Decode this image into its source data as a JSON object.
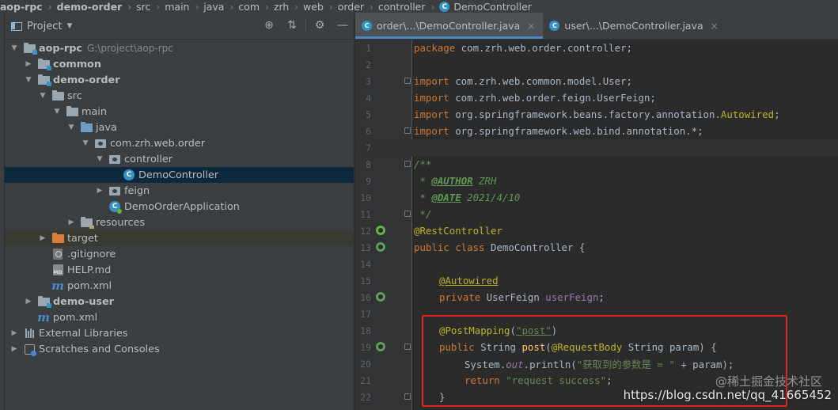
{
  "breadcrumb": {
    "items": [
      "aop-rpc",
      "demo-order",
      "src",
      "main",
      "java",
      "com",
      "zrh",
      "web",
      "order",
      "controller",
      "DemoController"
    ]
  },
  "project_panel": {
    "title": "Project",
    "tree": [
      {
        "label": "aop-rpc",
        "hint": "G:\\project\\aop-rpc"
      },
      {
        "label": "common"
      },
      {
        "label": "demo-order"
      },
      {
        "label": "src"
      },
      {
        "label": "main"
      },
      {
        "label": "java"
      },
      {
        "label": "com.zrh.web.order"
      },
      {
        "label": "controller"
      },
      {
        "label": "DemoController"
      },
      {
        "label": "feign"
      },
      {
        "label": "DemoOrderApplication"
      },
      {
        "label": "resources"
      },
      {
        "label": "target"
      },
      {
        "label": ".gitignore"
      },
      {
        "label": "HELP.md"
      },
      {
        "label": "pom.xml"
      },
      {
        "label": "demo-user"
      },
      {
        "label": "pom.xml"
      },
      {
        "label": "External Libraries"
      },
      {
        "label": "Scratches and Consoles"
      }
    ]
  },
  "editor": {
    "tabs": [
      {
        "label": "order\\...\\DemoController.java",
        "active": true
      },
      {
        "label": "user\\...\\DemoController.java",
        "active": false
      }
    ],
    "line_numbers": [
      "1",
      "2",
      "3",
      "4",
      "5",
      "6",
      "7",
      "8",
      "9",
      "10",
      "11",
      "12",
      "13",
      "14",
      "15",
      "16",
      "17",
      "18",
      "19",
      "20",
      "21",
      "22"
    ],
    "lines": {
      "l1": [
        "package",
        " com.zrh.web.order.controller;"
      ],
      "l3": [
        "import",
        " com.zrh.web.common.model.User;"
      ],
      "l4": [
        "import",
        " com.zrh.web.order.feign.UserFeign;"
      ],
      "l5": [
        "import",
        " org.springframework.beans.factory.annotation.",
        "Autowired",
        ";"
      ],
      "l6": [
        "import",
        " org.springframework.web.bind.annotation.*;"
      ],
      "l8": "/**",
      "l9": [
        " * ",
        "@AUTHOR",
        " ZRH"
      ],
      "l10": [
        " * ",
        "@DATE",
        " 2021/4/10"
      ],
      "l11": " */",
      "l12": "@RestController",
      "l13": [
        "public class",
        " DemoController {"
      ],
      "l15": "@Autowired",
      "l16": [
        "private",
        " UserFeign ",
        "userFeign",
        ";"
      ],
      "l18": [
        "@PostMapping",
        "(",
        "\"post\"",
        ")"
      ],
      "l19": [
        "public",
        " String ",
        "post",
        "(",
        "@RequestBody",
        " String param) {"
      ],
      "l20": [
        "System.",
        "out",
        ".println(",
        "\"获取到的参数是 = \"",
        " + param);"
      ],
      "l21": [
        "return",
        " ",
        "\"request success\"",
        ";"
      ],
      "l22": "}"
    }
  },
  "watermark": "https://blog.csdn.net/qq_41665452",
  "watermark_overlay": "@稀土掘金技术社区",
  "colors": {
    "highlight_box": "#e0231b",
    "keyword": "#cc7832",
    "annotation": "#bbb529",
    "string": "#6a8759"
  }
}
